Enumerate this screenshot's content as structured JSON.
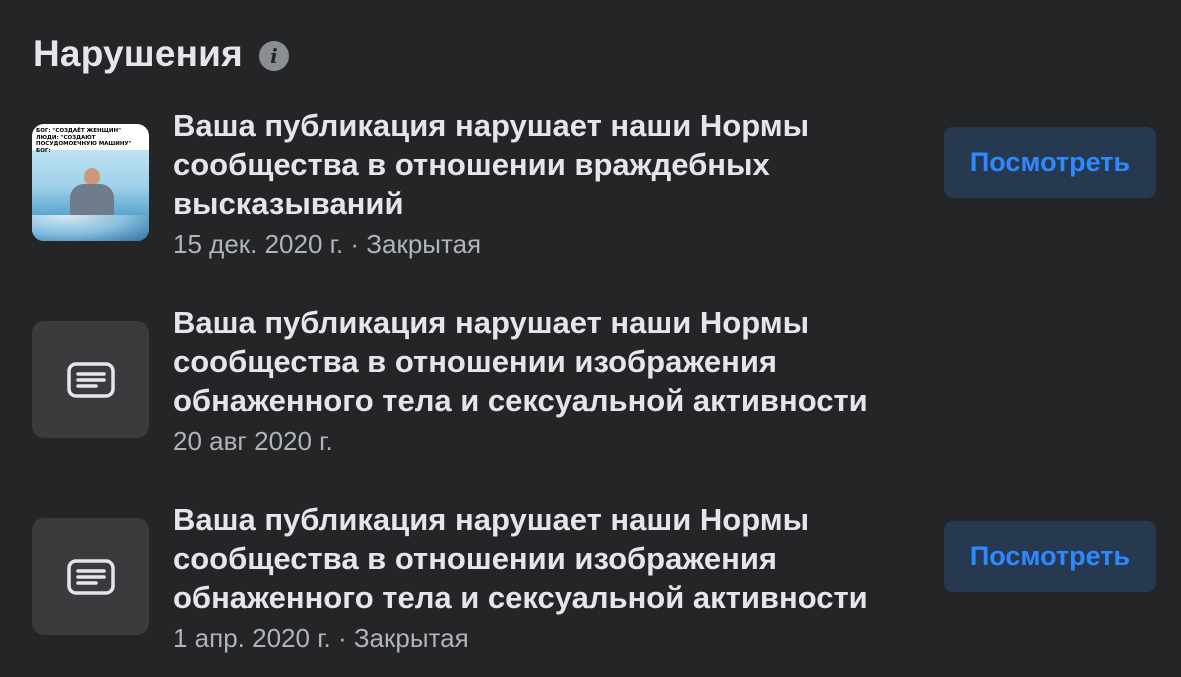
{
  "header": {
    "title": "Нарушения",
    "info_icon": "info-icon"
  },
  "items": [
    {
      "title": "Ваша публикация нарушает наши Нормы\nсообщества в отношении враждебных\nвысказываний",
      "meta": "15 дек. 2020 г. · Закрытая",
      "thumbnail": "photo",
      "thumbnail_caption": "БОГ: \"СОЗДАЁТ ЖЕНЩИН\"\nЛЮДИ: \"СОЗДАЮТ ПОСУДОМОЕЧНУЮ МАШИНУ\"\nБОГ:",
      "button_label": "Посмотреть"
    },
    {
      "title": "Ваша публикация нарушает наши Нормы\nсообщества в отношении изображения\nобнаженного тела и сексуальной активности",
      "meta": "20 авг 2020 г.",
      "thumbnail": "text-post-icon",
      "button_label": null
    },
    {
      "title": "Ваша публикация нарушает наши Нормы\nсообщества в отношении изображения\nобнаженного тела и сексуальной активности",
      "meta": "1 апр. 2020 г. · Закрытая",
      "thumbnail": "text-post-icon",
      "button_label": "Посмотреть"
    }
  ],
  "colors": {
    "background": "#242526",
    "primary_text": "#e4e6eb",
    "secondary_text": "#b0b3b8",
    "button_bg": "#263951",
    "button_text": "#2e89ff",
    "thumb_placeholder": "#3a3b3c"
  }
}
